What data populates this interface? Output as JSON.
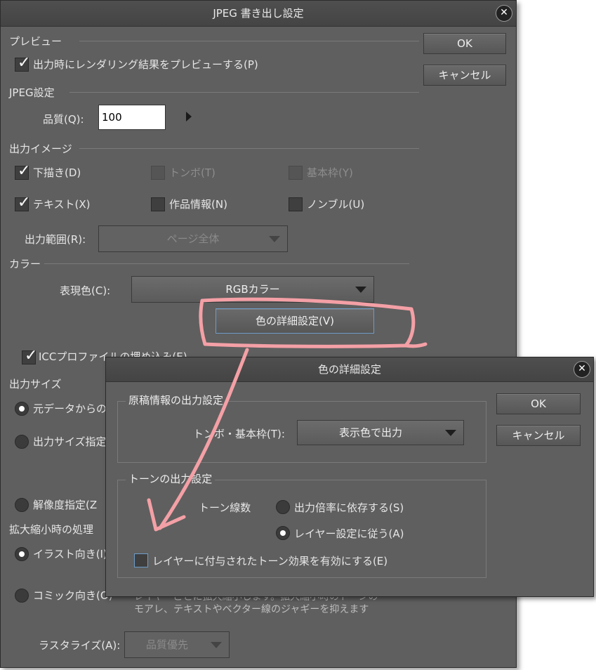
{
  "main": {
    "title": "JPEG 書き出し設定",
    "ok": "OK",
    "cancel": "キャンセル",
    "preview": {
      "group": "プレビュー",
      "render_preview": "出力時にレンダリング結果をプレビューする(P)"
    },
    "jpeg": {
      "group": "JPEG設定",
      "quality_label": "品質(Q):",
      "quality_value": "100"
    },
    "output_image": {
      "group": "出力イメージ",
      "draft": "下描き(D)",
      "tombo": "トンボ(T)",
      "basic_frame": "基本枠(Y)",
      "text": "テキスト(X)",
      "work_info": "作品情報(N)",
      "nombre": "ノンブル(U)",
      "range_label": "出力範囲(R):",
      "range_value": "ページ全体"
    },
    "color": {
      "group": "カラー",
      "expression_label": "表現色(C):",
      "expression_value": "RGBカラー",
      "detail_button": "色の詳細設定(V)",
      "icc": "ICCプロファイルの埋め込み(E)"
    },
    "output_size": {
      "group": "出力サイズ",
      "from_original": "元データからの",
      "size_specify": "出力サイズ指定",
      "resolution": "解像度指定(Z"
    },
    "scaling": {
      "group": "拡大縮小時の処理",
      "illust": "イラスト向き(I)",
      "comic": "コミック向き(O)",
      "desc_line1": "レイヤーごとに拡大縮小します。拡大縮小時のトーンの",
      "desc_line2": "モアレ、テキストやベクター線のジャギーを抑えます"
    },
    "rasterize": {
      "label": "ラスタライズ(A):",
      "value": "品質優先"
    }
  },
  "sub": {
    "title": "色の詳細設定",
    "ok": "OK",
    "cancel": "キャンセル",
    "draft_info": {
      "group": "原稿情報の出力設定",
      "tombo_label": "トンボ・基本枠(T):",
      "tombo_value": "表示色で出力"
    },
    "tone": {
      "group": "トーンの出力設定",
      "lines_label": "トーン線数",
      "depend_ratio": "出力倍率に依存する(S)",
      "follow_layer": "レイヤー設定に従う(A)",
      "enable_effect": "レイヤーに付与されたトーン効果を有効にする(E)"
    }
  },
  "colors": {
    "annotation": "#f4a0a6",
    "panel": "#5f5f5f",
    "focus": "#6d9cc9"
  }
}
